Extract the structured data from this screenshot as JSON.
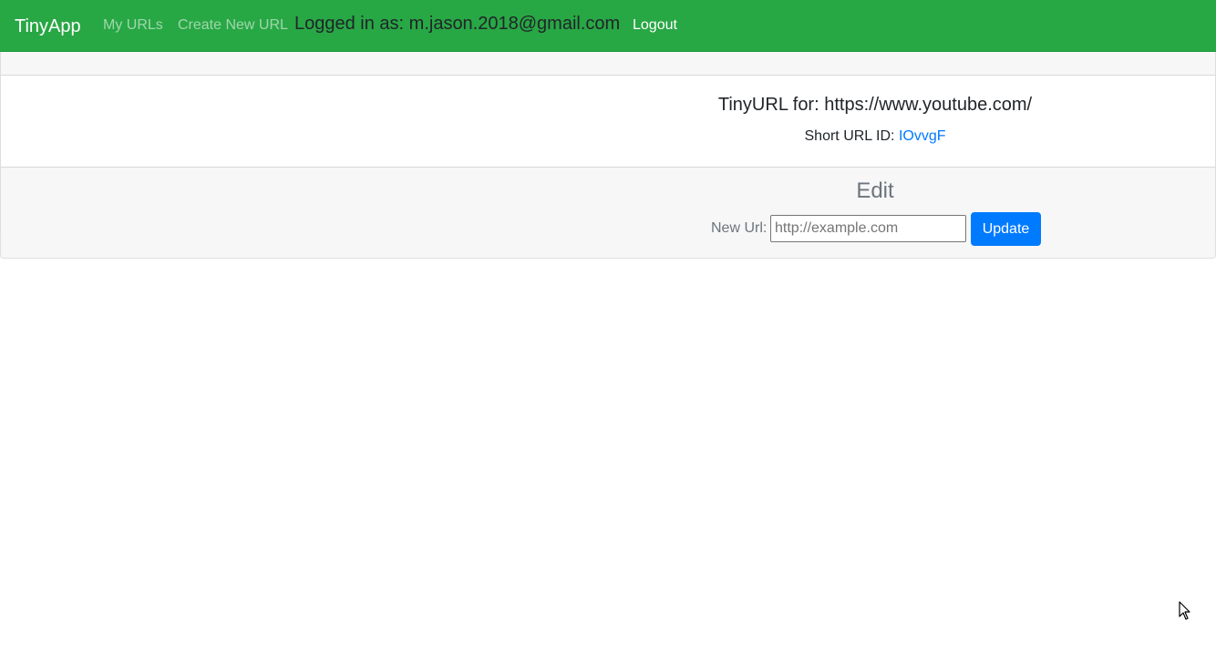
{
  "navbar": {
    "brand": "TinyApp",
    "links": [
      {
        "label": "My URLs"
      },
      {
        "label": "Create New URL"
      }
    ],
    "logged_in_text": "Logged in as: m.jason.2018@gmail.com",
    "logout_label": "Logout",
    "background_color": "#28a745"
  },
  "card": {
    "title": "TinyURL for: https://www.youtube.com/",
    "short_url_label": "Short URL ID: ",
    "short_url_id": "IOvvgF",
    "edit": {
      "heading": "Edit",
      "new_url_label": "New Url:",
      "input_value": "",
      "input_placeholder": "http://example.com",
      "update_label": "Update"
    }
  },
  "colors": {
    "accent": "#007bff",
    "muted": "#6c757d"
  },
  "icons": {
    "cursor": "mouse-pointer-icon"
  }
}
